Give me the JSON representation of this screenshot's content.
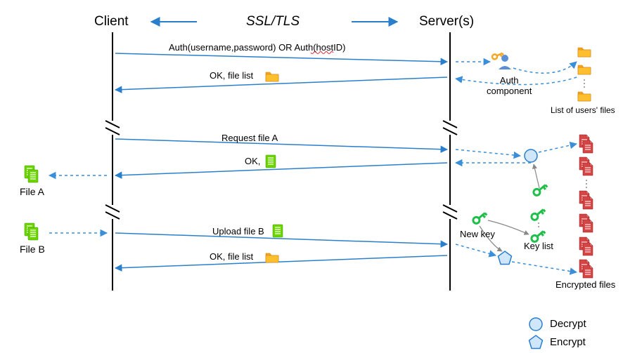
{
  "header": {
    "client": "Client",
    "server": "Server(s)",
    "title": "SSL/TLS"
  },
  "msgs": {
    "auth_req_a": "Auth(username,password) OR Auth(",
    "auth_req_host": "hostID",
    "auth_req_z": ")",
    "ok_list": "OK, file list",
    "req_file_a": "Request file A",
    "ok_file_a": "OK,",
    "upload_b": "Upload file B",
    "ok_list2": "OK, file list"
  },
  "comp": {
    "auth": "Auth\ncomponent",
    "users_files": "List of users' files",
    "new_key": "New key",
    "key_list": "Key list",
    "encrypted": "Encrypted files"
  },
  "files": {
    "a": "File A",
    "b": "File B"
  },
  "legend": {
    "decrypt": "Decrypt",
    "encrypt": "Encrypt"
  }
}
